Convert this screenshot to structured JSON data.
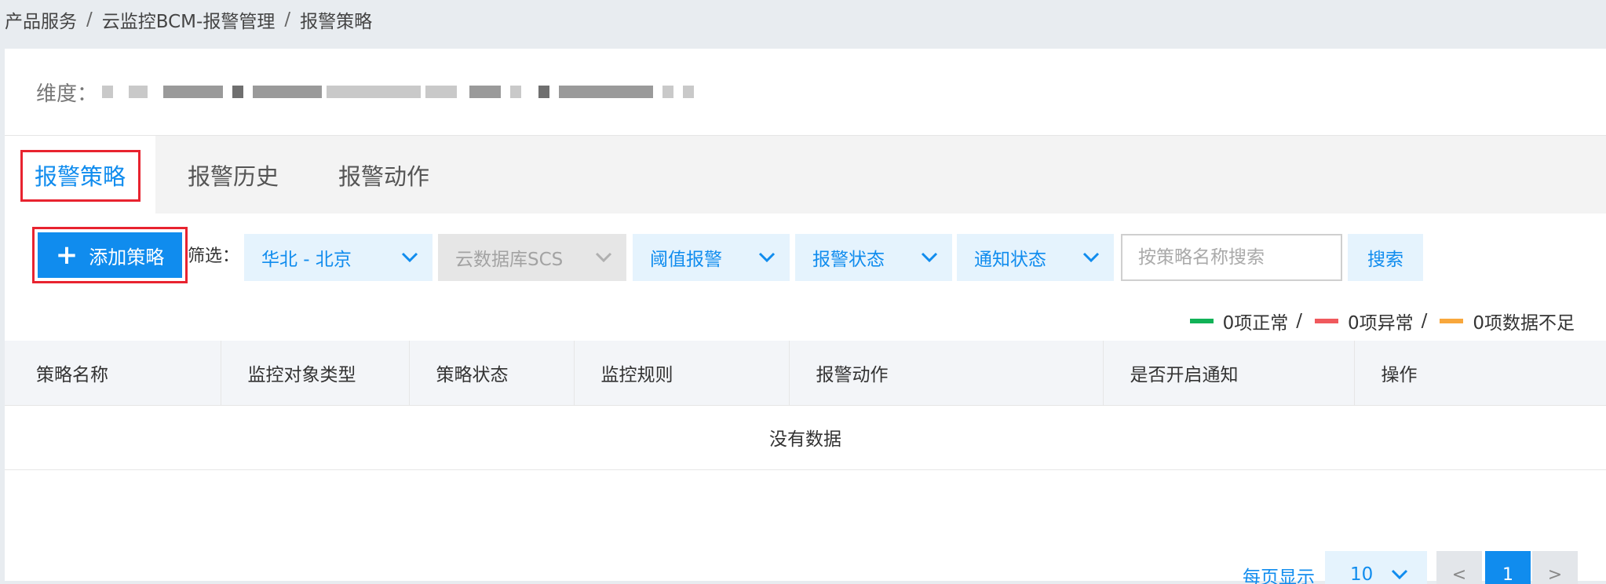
{
  "breadcrumb": [
    "产品服务",
    "云监控BCM-报警管理",
    "报警策略"
  ],
  "breadcrumb_sep": "/",
  "dimension": {
    "label": "维度："
  },
  "tabs": [
    {
      "label": "报警策略",
      "active": true
    },
    {
      "label": "报警历史",
      "active": false
    },
    {
      "label": "报警动作",
      "active": false
    }
  ],
  "toolbar": {
    "add_label": "添加策略",
    "filter_label": "筛选：",
    "selects": [
      {
        "value": "华北 - 北京",
        "disabled": false
      },
      {
        "value": "云数据库SCS",
        "disabled": true
      },
      {
        "value": "阈值报警",
        "disabled": false
      },
      {
        "value": "报警状态",
        "disabled": false
      },
      {
        "value": "通知状态",
        "disabled": false
      }
    ],
    "search_placeholder": "按策略名称搜索",
    "search_label": "搜索"
  },
  "legend": {
    "items": [
      {
        "text": "0项正常",
        "color": "#11b257"
      },
      {
        "text": "0项异常",
        "color": "#f0595d"
      },
      {
        "text": "0项数据不足",
        "color": "#f8a73c"
      }
    ],
    "sep": "/"
  },
  "table": {
    "columns": [
      "策略名称",
      "监控对象类型",
      "策略状态",
      "监控规则",
      "报警动作",
      "是否开启通知",
      "操作"
    ],
    "empty_text": "没有数据"
  },
  "pagination": {
    "per_page_label": "每页显示",
    "per_page_value": "10",
    "prev": "<",
    "current": "1",
    "next": ">"
  },
  "colors": {
    "accent": "#108cee",
    "highlight_border": "#e8232f"
  }
}
